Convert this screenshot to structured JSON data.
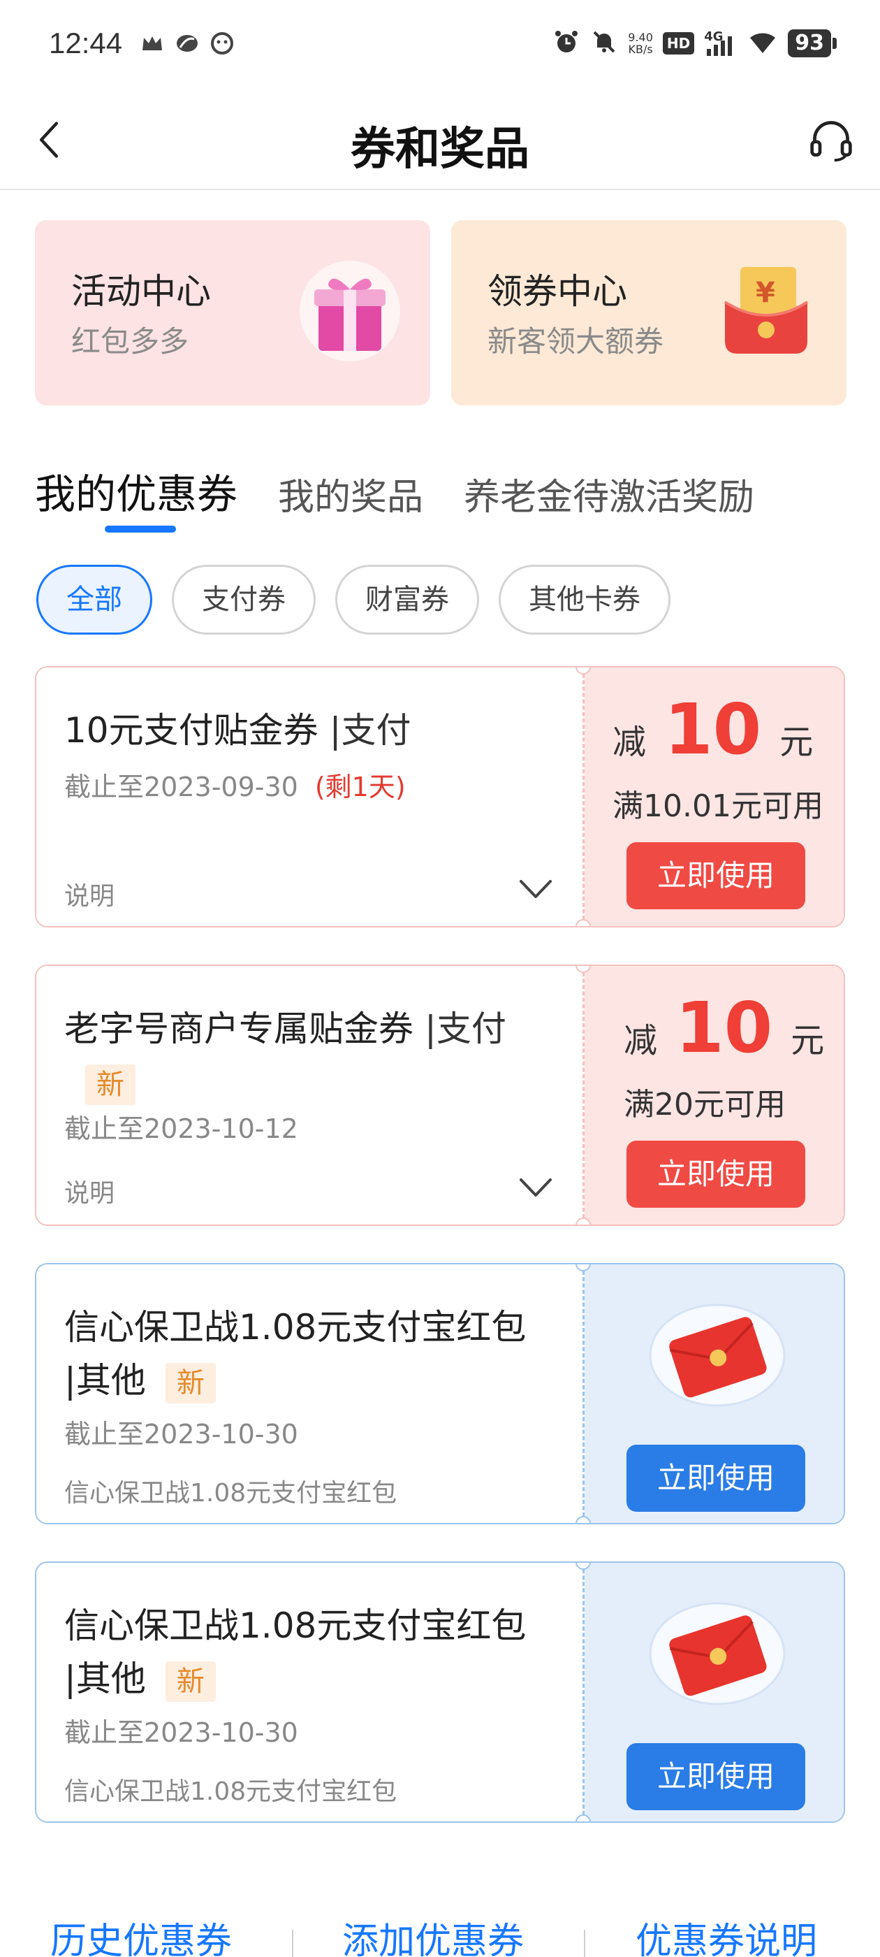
{
  "status_bar": {
    "time": "12:44",
    "net_speed_value": "9.40",
    "net_speed_unit": "KB/s",
    "network_label": "4G",
    "hd_label": "HD",
    "battery": "93"
  },
  "header": {
    "title": "券和奖品"
  },
  "promos": [
    {
      "title": "活动中心",
      "subtitle": "红包多多",
      "icon": "gift-box-icon"
    },
    {
      "title": "领券中心",
      "subtitle": "新客领大额券",
      "icon": "red-envelope-icon",
      "currency": "¥"
    }
  ],
  "tabs": [
    "我的优惠券",
    "我的奖品",
    "养老金待激活奖励"
  ],
  "filters": [
    "全部",
    "支付券",
    "财富券",
    "其他卡券"
  ],
  "coupons": [
    {
      "style": "red",
      "title": "10元支付贴金券",
      "category": "|支付",
      "expiry": "截止至2023-09-30",
      "remain": "(剩1天)",
      "desc": "说明",
      "amount_prefix": "减",
      "amount": "10",
      "amount_unit": "元",
      "threshold": "满10.01元可用",
      "button": "立即使用"
    },
    {
      "style": "red",
      "title": "老字号商户专属贴金券",
      "category": "|支付",
      "badge": "新",
      "expiry": "截止至2023-10-12",
      "desc": "说明",
      "amount_prefix": "减",
      "amount": "10",
      "amount_unit": "元",
      "threshold": "满20元可用",
      "button": "立即使用"
    },
    {
      "style": "blue",
      "title": "信心保卫战1.08元支付宝红包",
      "category": "|其他",
      "badge": "新",
      "expiry": "截止至2023-10-30",
      "desc": "信心保卫战1.08元支付宝红包",
      "button": "立即使用"
    },
    {
      "style": "blue",
      "title": "信心保卫战1.08元支付宝红包",
      "category": "|其他",
      "badge": "新",
      "expiry": "截止至2023-10-30",
      "desc": "信心保卫战1.08元支付宝红包",
      "button": "立即使用"
    }
  ],
  "bottom_links": [
    "历史优惠券",
    "添加优惠券",
    "优惠券说明"
  ],
  "colors": {
    "accent": "#1677ff",
    "coupon_red": "#ef3f36",
    "button_red": "#f04a44",
    "button_blue": "#2a7ce6",
    "badge_orange": "#e58a2a"
  }
}
